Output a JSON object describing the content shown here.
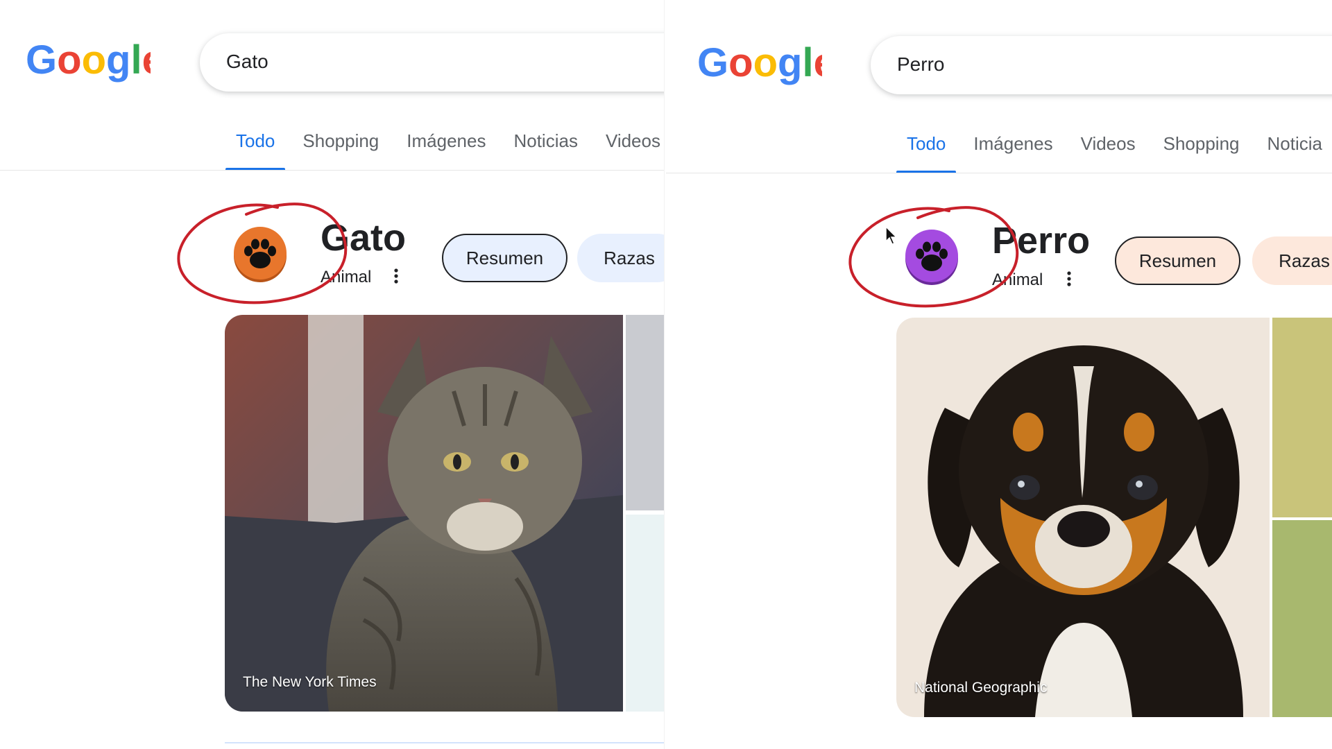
{
  "panels": [
    {
      "logo_text": "Google",
      "query": "Gato",
      "tabs": [
        "Todo",
        "Shopping",
        "Imágenes",
        "Noticias",
        "Videos"
      ],
      "active_tab": "Todo",
      "entity": {
        "title": "Gato",
        "subtitle": "Animal",
        "icon": "paw-icon",
        "icon_color": "#e8762c",
        "chips": [
          "Resumen",
          "Razas"
        ]
      },
      "image_caption": "The New York Times",
      "annotation": "red-circle-around-paw-icon"
    },
    {
      "logo_text": "Google",
      "query": "Perro",
      "tabs": [
        "Todo",
        "Imágenes",
        "Videos",
        "Shopping",
        "Noticia"
      ],
      "active_tab": "Todo",
      "entity": {
        "title": "Perro",
        "subtitle": "Animal",
        "icon": "paw-icon",
        "icon_color": "#a44be0",
        "chips": [
          "Resumen",
          "Razas"
        ]
      },
      "image_caption": "National Geographic",
      "annotation": "red-circle-around-paw-icon"
    }
  ],
  "colors": {
    "tab_active": "#1a73e8",
    "annotation_red": "#c8202a",
    "google_blue": "#4285f4",
    "google_red": "#ea4335",
    "google_yellow": "#fbbc05",
    "google_green": "#34a853"
  }
}
